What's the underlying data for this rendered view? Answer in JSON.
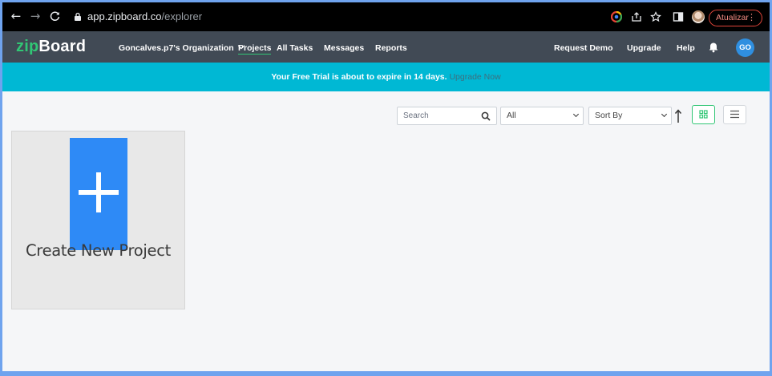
{
  "browser": {
    "url_host": "app.zipboard.co",
    "url_path": "/explorer",
    "update_label": "Atualizar",
    "icons": [
      "back-icon",
      "forward-icon",
      "reload-icon",
      "lock-icon",
      "google-icon",
      "share-icon",
      "star-icon",
      "sidepanel-icon",
      "profile-avatar",
      "menu-dots-icon"
    ]
  },
  "app": {
    "logo_zip": "zip",
    "logo_board": "Board",
    "org_label": "Goncalves.p7's Organization",
    "nav": {
      "projects": "Projects",
      "all_tasks": "All Tasks",
      "messages": "Messages",
      "reports": "Reports"
    },
    "right": {
      "request_demo": "Request Demo",
      "upgrade": "Upgrade",
      "help": "Help",
      "avatar_initials": "GO"
    }
  },
  "banner": {
    "message": "Your Free Trial is about to expire in 14 days.",
    "link": "Upgrade Now"
  },
  "toolbar": {
    "search_placeholder": "Search",
    "filter_value": "All",
    "sort_value": "Sort By"
  },
  "card": {
    "label": "Create New Project"
  },
  "colors": {
    "brand_green": "#31c675",
    "nav_bg": "#414a55",
    "banner_bg": "#00b8d4",
    "accent_blue": "#2e8af6"
  }
}
